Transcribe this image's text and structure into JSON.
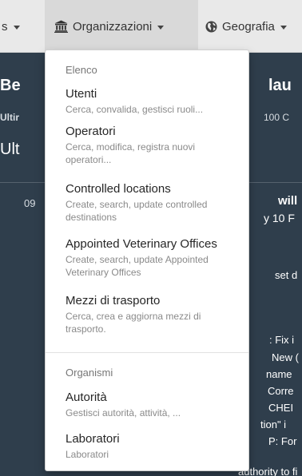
{
  "navbar": {
    "item_left_fragment": "s",
    "organizzazioni": "Organizzazioni",
    "geografia": "Geografia"
  },
  "background": {
    "heading_left": "Be",
    "heading_right": "lau",
    "sub_left": "Ultir",
    "sub_right": "100 C",
    "section_left": "Ult",
    "row_num": "09",
    "bold_right_1": "will",
    "bold_right_2": "y 10 F",
    "plain_right_1": "set d",
    "list_right": [
      ": Fix i",
      "New (",
      "name",
      "Corre",
      "CHEI",
      "tion\" i",
      "P: For",
      "authority to fi"
    ]
  },
  "dropdown": {
    "header_elenco": "Elenco",
    "items": [
      {
        "title": "Utenti",
        "desc": "Cerca, convalida, gestisci ruoli..."
      },
      {
        "title": "Operatori",
        "desc": "Cerca, modifica, registra nuovi operatori..."
      },
      {
        "title": "Controlled locations",
        "desc": "Create, search, update controlled destinations"
      },
      {
        "title": "Appointed Veterinary Offices",
        "desc": "Create, search, update Appointed Veterinary Offices"
      },
      {
        "title": "Mezzi di trasporto",
        "desc": "Cerca, crea e aggiorna mezzi di trasporto."
      }
    ],
    "header_organismi": "Organismi",
    "items2": [
      {
        "title": "Autorità",
        "desc": "Gestisci autorità, attività, ..."
      },
      {
        "title": "Laboratori",
        "desc": "Laboratori"
      }
    ]
  }
}
